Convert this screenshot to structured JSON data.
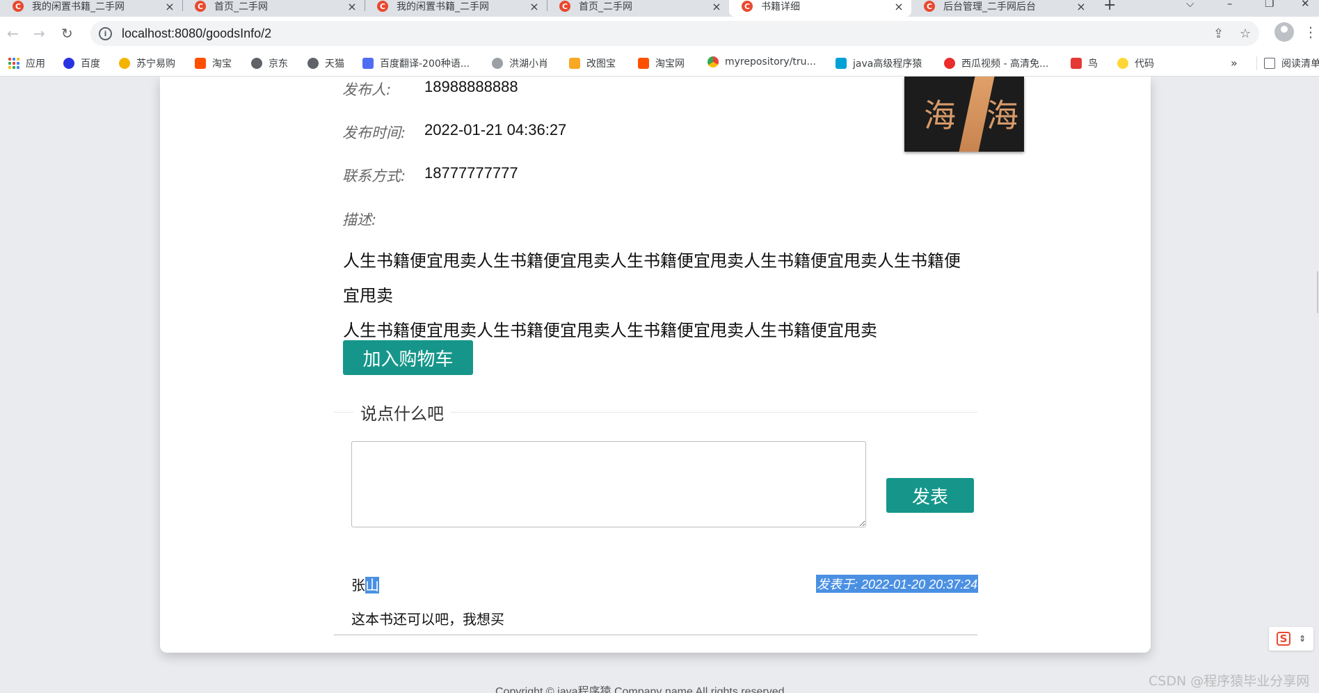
{
  "browser": {
    "tabs": [
      {
        "title": "我的闲置书籍_二手网",
        "active": false
      },
      {
        "title": "首页_二手网",
        "active": false
      },
      {
        "title": "我的闲置书籍_二手网",
        "active": false
      },
      {
        "title": "首页_二手网",
        "active": false
      },
      {
        "title": "书籍详细",
        "active": true
      },
      {
        "title": "后台管理_二手网后台",
        "active": false
      }
    ],
    "tab_favicon_letter": "C",
    "close_glyph": "×",
    "new_tab_glyph": "+",
    "url": "localhost:8080/goodsInfo/2",
    "bookmarks": [
      {
        "label": "应用",
        "icon": "apps-grid-icon",
        "color": "#4285f4"
      },
      {
        "label": "百度",
        "icon": "baidu-paw-icon",
        "color": "#2932e1"
      },
      {
        "label": "苏宁易购",
        "icon": "suning-lion-icon",
        "color": "#f4b400"
      },
      {
        "label": "淘宝",
        "icon": "taobao-icon",
        "color": "#ff5000"
      },
      {
        "label": "京东",
        "icon": "globe-icon",
        "color": "#5f6368"
      },
      {
        "label": "天猫",
        "icon": "globe-icon",
        "color": "#5f6368"
      },
      {
        "label": "百度翻译-200种语...",
        "icon": "baidu-translate-icon",
        "color": "#4e6ef2"
      },
      {
        "label": "洪湖小肖",
        "icon": "bird-icon",
        "color": "#9aa0a6"
      },
      {
        "label": "改图宝",
        "icon": "gaitubao-icon",
        "color": "#f9a825"
      },
      {
        "label": "淘宝网",
        "icon": "taobao-icon",
        "color": "#ff5000"
      },
      {
        "label": "myrepository/tru...",
        "icon": "chrome-icon",
        "color": "#34a853"
      },
      {
        "label": "java高级程序猿",
        "icon": "bilibili-tv-icon",
        "color": "#00a1d6"
      },
      {
        "label": "西瓜视频 - 高清免...",
        "icon": "xigua-icon",
        "color": "#ea2c2c"
      },
      {
        "label": "鸟",
        "icon": "bird-red-icon",
        "color": "#e53935"
      },
      {
        "label": "代码",
        "icon": "circle-icon",
        "color": "#fdd835"
      }
    ],
    "bookmarks_overflow": "»",
    "reading_list": "阅读清单"
  },
  "page": {
    "publisher_label": "发布人:",
    "publisher_value": "18988888888",
    "publish_time_label": "发布时间:",
    "publish_time_value": "2022-01-21 04:36:27",
    "contact_label": "联系方式:",
    "contact_value": "18777777777",
    "description_label": "描述:",
    "description_lines": [
      "人生书籍便宜甩卖人生书籍便宜甩卖人生书籍便宜甩卖人生书籍便宜甩卖人生书籍便宜甩卖",
      "人生书籍便宜甩卖人生书籍便宜甩卖人生书籍便宜甩卖人生书籍便宜甩卖"
    ],
    "book_cover_chars": [
      "海",
      "海"
    ],
    "add_to_cart_label": "加入购物车",
    "comment_legend": "说点什么吧",
    "comment_placeholder": "",
    "post_button_label": "发表",
    "comments": [
      {
        "author_first": "张",
        "author_rest": "山",
        "time": "发表于: 2022-01-20 20:37:24",
        "text": "这本书还可以吧，我想买"
      }
    ],
    "footer": "Copyright © java程序猿 Company name All rights reserved"
  },
  "watermark": "CSDN @程序猿毕业分享网",
  "colors": {
    "accent_button": "#16968a",
    "selection": "#4a90e2",
    "favicon": "#e8492f"
  }
}
